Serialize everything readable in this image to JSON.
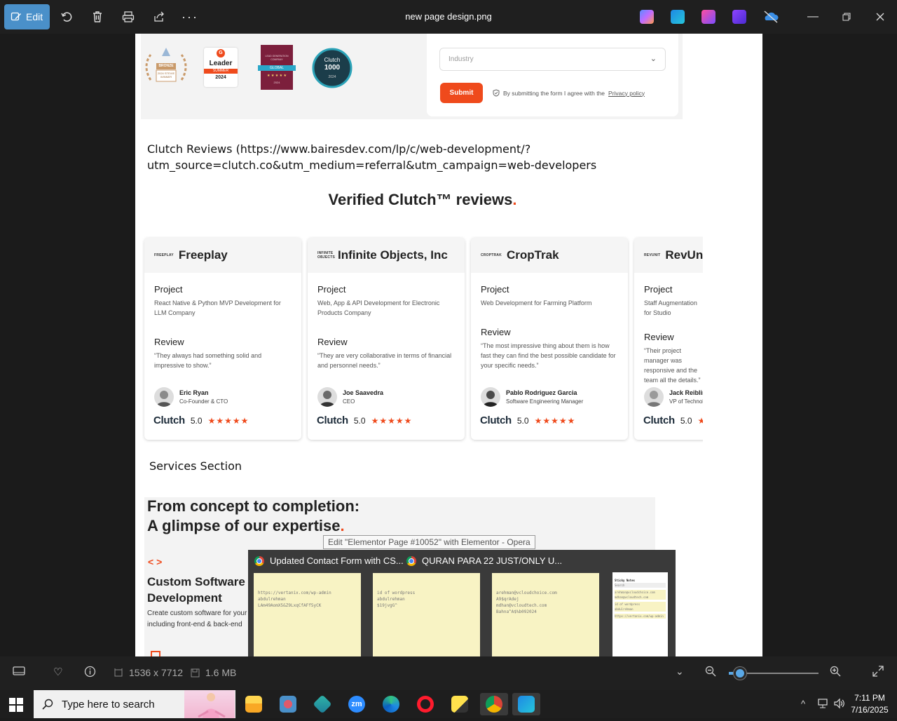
{
  "viewer": {
    "edit_label": "Edit",
    "file_name": "new page design.png",
    "dimensions": "1536 x 7712",
    "file_size": "1.6 MB"
  },
  "form": {
    "industry_placeholder": "Industry",
    "submit_label": "Submit",
    "consent_text": "By submitting the form I agree with the",
    "privacy_link": "Privacy policy"
  },
  "badges": {
    "stevie": [
      "BRONZE",
      "2024 STEVIE",
      "WINNER"
    ],
    "leader": [
      "Leader",
      "SUMMER",
      "2024"
    ],
    "global": [
      "LEAD GENERATION",
      "COMPANY",
      "GLOBAL",
      "★ ★ ★ ★ ★",
      "2024"
    ],
    "clutch1000": [
      "Clutch",
      "1000",
      "2024"
    ]
  },
  "clutch_link_text": "Clutch Reviews (https://www.bairesdev.com/lp/c/web-development/?utm_source=clutch.co&utm_medium=referral&utm_campaign=web-developers",
  "reviews_heading": "Verified Clutch™ reviews",
  "reviews_heading_dot": ".",
  "reviews": [
    {
      "logo": "FREEPLAY",
      "company": "Freeplay",
      "project_label": "Project",
      "project": "React Native & Python MVP Development for LLM Company",
      "review_label": "Review",
      "review": "“They always had something solid and impressive to show.”",
      "name": "Eric Ryan",
      "role": "Co-Founder & CTO",
      "clutch": "Clutch",
      "score": "5.0",
      "stars": "★★★★★"
    },
    {
      "logo": "INFINITE OBJECTS",
      "company": "Infinite Objects, Inc",
      "project_label": "Project",
      "project": "Web, App & API Development for Electronic Products Company",
      "review_label": "Review",
      "review": "“They are very collaborative in terms of financial and personnel needs.”",
      "name": "Joe Saavedra",
      "role": "CEO",
      "clutch": "Clutch",
      "score": "5.0",
      "stars": "★★★★★"
    },
    {
      "logo": "CROPTRAK",
      "company": "CropTrak",
      "project_label": "Project",
      "project": "Web Development for Farming Platform",
      "review_label": "Review",
      "review": "“The most impressive thing about them is how fast they can find the best possible candidate for your specific needs.”",
      "name": "Pablo Rodriguez Garcia",
      "role": "Software Engineering Manager",
      "clutch": "Clutch",
      "score": "5.0",
      "stars": "★★★★★"
    },
    {
      "logo": "REVUNIT",
      "company": "RevUnit",
      "project_label": "Project",
      "project": "Staff Augmentation for Studio",
      "review_label": "Review",
      "review": "“Their project manager was responsive and the team all the details.”",
      "name": "Jack Reibling",
      "role": "VP of Technology",
      "clutch": "Clutch",
      "score": "5.0",
      "stars": "★★★★★"
    }
  ],
  "services_label": "Services Section",
  "expertise": {
    "line1": "From concept to completion:",
    "line2": "A glimpse of our expertise",
    "dot": ".",
    "code_icon": "< >",
    "service_title_1": "Custom Software",
    "service_title_2": "Development",
    "service_desc_1": "Create custom software for your",
    "service_desc_2": "including front-end & back-end"
  },
  "tooltip": "Edit \"Elementor Page #10052\" with Elementor - Opera",
  "preview": {
    "window1": "Updated Contact Form with CS...",
    "window2": "QURAN PARA 22 JUST/ONLY U...",
    "thumbs": [
      [
        "https://vertanix.com/wp-admin",
        "abdulrehman",
        "LAm49AomX5&Z9LxqCfAFf5yCK"
      ],
      [
        "id of wordpress",
        "abdulrehman",
        "$19jvgG^"
      ],
      [
        "arehman@vcloudchoice.com",
        "A9$qrAdej",
        "mdhan@vcloudtech.com",
        "Bahna^A$%b092024"
      ],
      [
        "Sticky Notes",
        "Search",
        "arehman@vcloudchoice.com",
        "mdhan@vcloudtech.com",
        "id of wordpress",
        "abdulrehman",
        "https://vertanix.com/wp-admin"
      ]
    ]
  },
  "taskbar": {
    "search_placeholder": "Type here to search",
    "time": "7:11 PM",
    "date": "7/16/2025"
  },
  "colors": {
    "accent": "#ef4a1c",
    "edit_button": "#4a90c9",
    "clutch_dark": "#1c2b39"
  }
}
